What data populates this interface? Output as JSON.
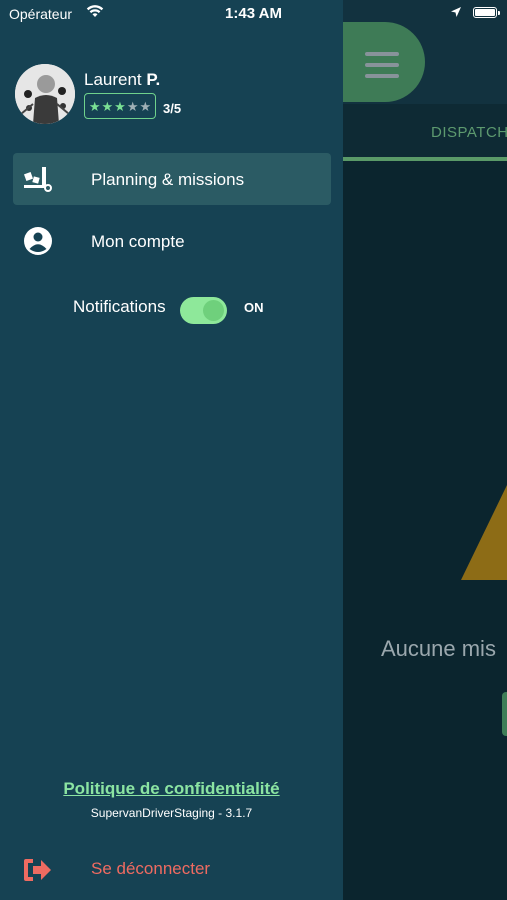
{
  "status_bar": {
    "carrier": "Opérateur",
    "time": "1:43 AM"
  },
  "main": {
    "tab_label": "DISPATCH",
    "empty_text": "Aucune mis"
  },
  "drawer": {
    "user": {
      "first_name": "Laurent",
      "last_initial": "P.",
      "rating_text": "3/5",
      "rating_value": 3,
      "rating_max": 5
    },
    "menu": [
      {
        "label": "Planning & missions",
        "icon": "truck-boxes-icon",
        "active": true
      },
      {
        "label": "Mon compte",
        "icon": "account-circle-icon",
        "active": false
      }
    ],
    "notifications": {
      "label": "Notifications",
      "state_label": "ON",
      "enabled": true
    },
    "privacy_link": "Politique de confidentialité",
    "version": "SupervanDriverStaging - 3.1.7",
    "logout_label": "Se déconnecter"
  },
  "colors": {
    "drawer_bg": "#164253",
    "accent_green": "#8be4a2",
    "logout_red": "#ef6b61",
    "warning": "#8d6c16"
  }
}
